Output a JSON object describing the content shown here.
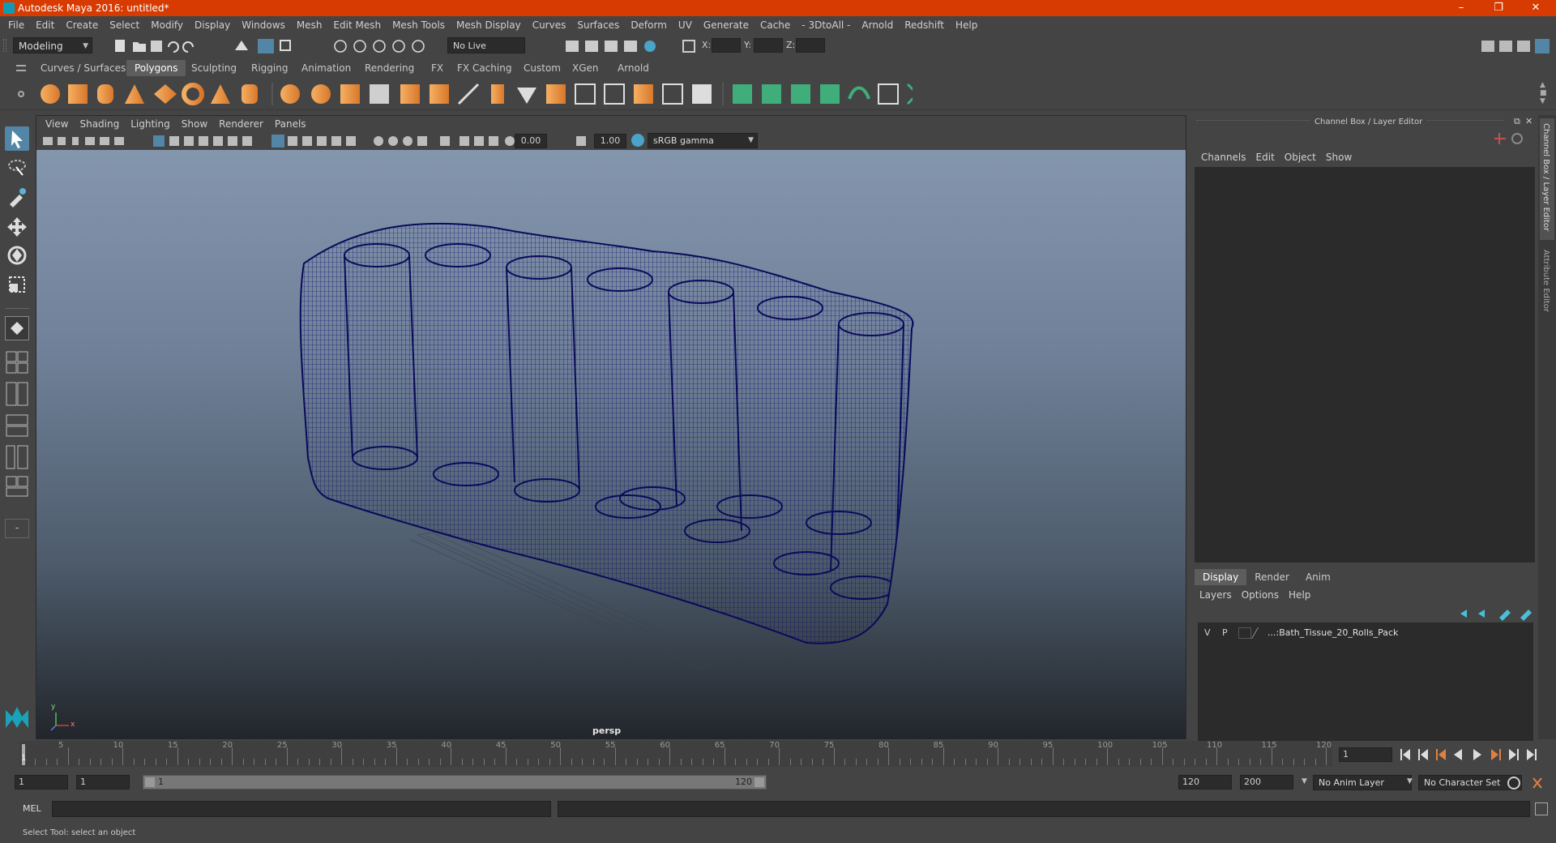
{
  "window": {
    "title": "Autodesk Maya 2016: untitled*",
    "controls": [
      "–",
      "❐",
      "✕"
    ]
  },
  "menubar": [
    "File",
    "Edit",
    "Create",
    "Select",
    "Modify",
    "Display",
    "Windows",
    "Mesh",
    "Edit Mesh",
    "Mesh Tools",
    "Mesh Display",
    "Curves",
    "Surfaces",
    "Deform",
    "UV",
    "Generate",
    "Cache",
    "- 3DtoAll -",
    "Arnold",
    "Redshift",
    "Help"
  ],
  "statusline": {
    "mode": "Modeling",
    "live_surface": "No Live Surface",
    "x_label": "X:",
    "y_label": "Y:",
    "z_label": "Z:"
  },
  "shelf": {
    "tabs": [
      "Curves / Surfaces",
      "Polygons",
      "Sculpting",
      "Rigging",
      "Animation",
      "Rendering",
      "FX",
      "FX Caching",
      "Custom",
      "XGen",
      "Arnold"
    ],
    "active": "Polygons"
  },
  "viewport": {
    "menus": [
      "View",
      "Shading",
      "Lighting",
      "Show",
      "Renderer",
      "Panels"
    ],
    "exposure": "0.00",
    "gamma": "1.00",
    "color_space": "sRGB gamma",
    "camera": "persp",
    "axis_x": "x",
    "axis_y": "y"
  },
  "channelbox": {
    "title": "Channel Box / Layer Editor",
    "menus": [
      "Channels",
      "Edit",
      "Object",
      "Show"
    ],
    "layer_tabs": [
      "Display",
      "Render",
      "Anim"
    ],
    "active_layer_tab": "Display",
    "layer_menus": [
      "Layers",
      "Options",
      "Help"
    ],
    "layer": {
      "v": "V",
      "p": "P",
      "name": "...:Bath_Tissue_20_Rolls_Pack"
    },
    "side_tab_1": "Channel Box / Layer Editor",
    "side_tab_2": "Attribute Editor"
  },
  "timeline": {
    "ticks": [
      "5",
      "10",
      "15",
      "20",
      "25",
      "30",
      "35",
      "40",
      "45",
      "50",
      "55",
      "60",
      "65",
      "70",
      "75",
      "80",
      "85",
      "90",
      "95",
      "100",
      "105",
      "110",
      "115",
      "120"
    ],
    "current_frame_marker": "1",
    "current_frame_field": "1"
  },
  "range": {
    "start": "1",
    "playback_start": "1",
    "slider_start": "1",
    "slider_end": "120",
    "playback_end": "120",
    "end": "200",
    "anim_layer": "No Anim Layer",
    "character_set": "No Character Set"
  },
  "cmdline": {
    "label": "MEL"
  },
  "helpline": {
    "text": "Select Tool: select an object"
  },
  "colors": {
    "titlebar": "#d83b01",
    "wireframe": "#0c0c6e",
    "accent": "#5285a6"
  }
}
